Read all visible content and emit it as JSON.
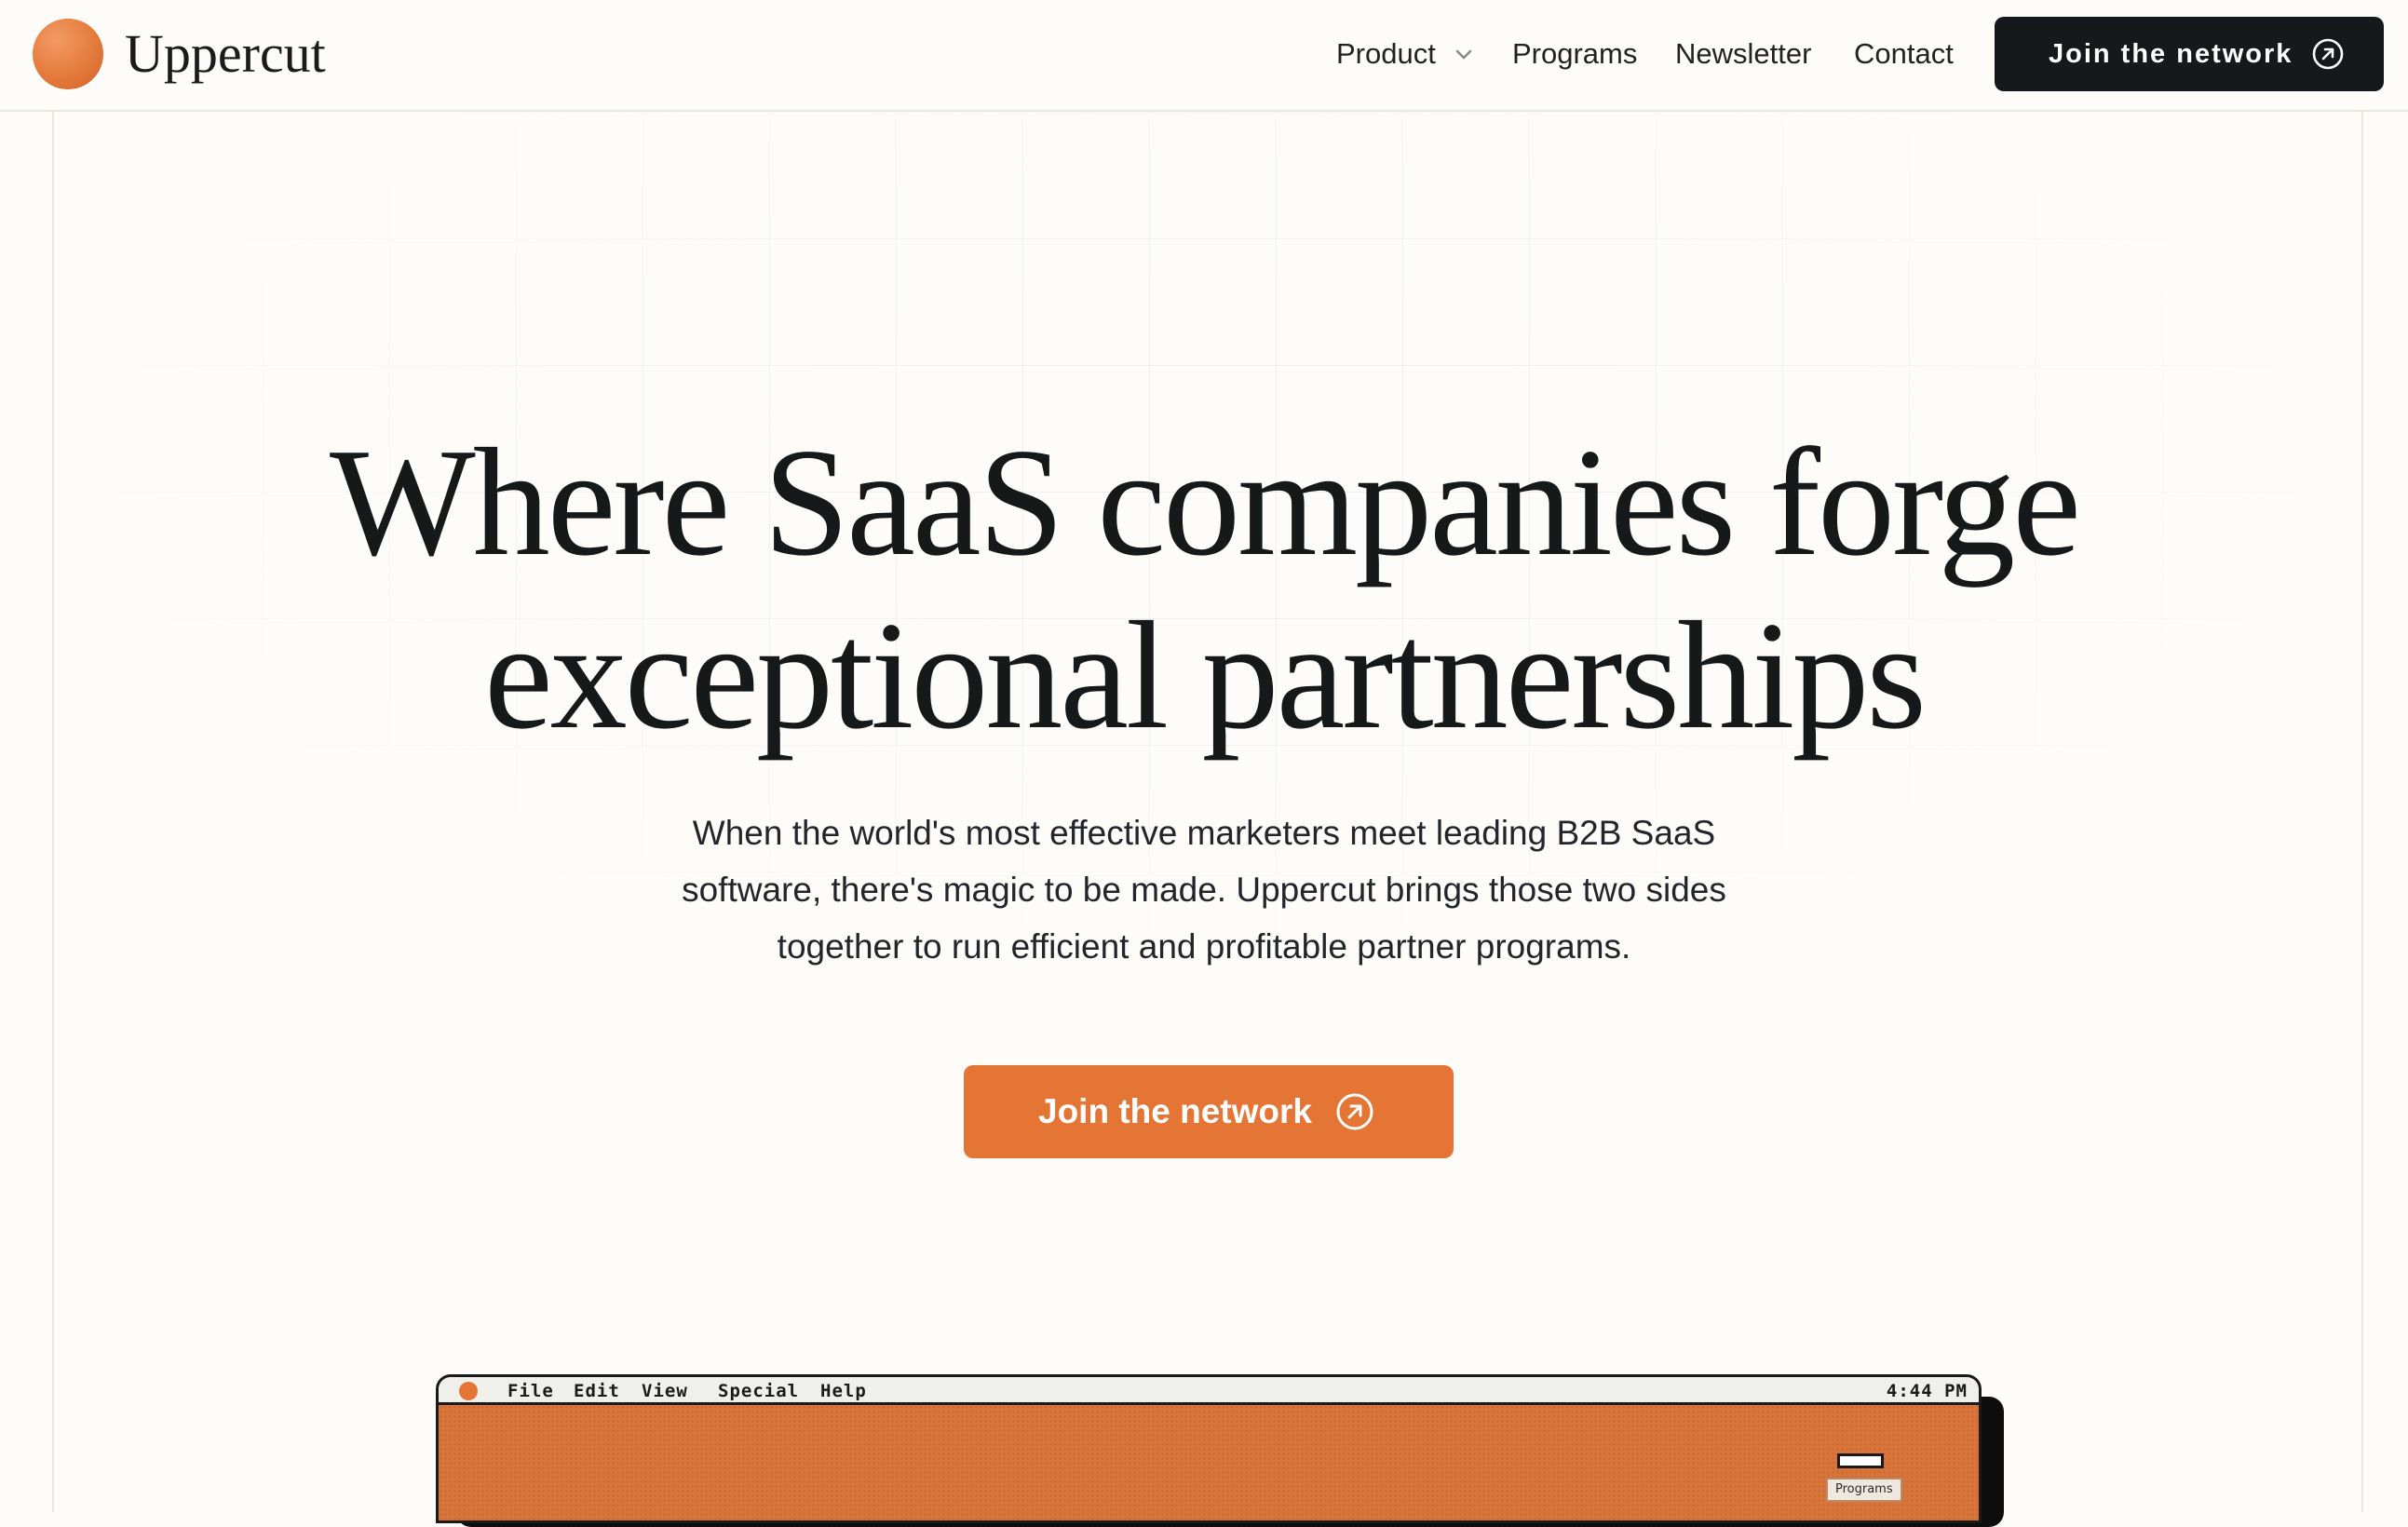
{
  "brand": {
    "name": "Uppercut",
    "accent": "#e57535",
    "dark": "#15191b"
  },
  "nav": {
    "items": [
      {
        "label": "Product",
        "has_dropdown": true
      },
      {
        "label": "Programs"
      },
      {
        "label": "Newsletter"
      },
      {
        "label": "Contact"
      }
    ],
    "cta_label": "Join the network",
    "cta_icon": "arrow-up-right-circle-icon"
  },
  "hero": {
    "headline_line1": "Where SaaS companies forge",
    "headline_line2": "exceptional partnerships",
    "subtext_line1": "When the world's most effective marketers meet leading B2B SaaS",
    "subtext_line2": "software, there's magic to be made. Uppercut brings those two sides",
    "subtext_line3": "together to run efficient and profitable partner programs.",
    "cta_label": "Join the network",
    "cta_icon": "arrow-up-right-circle-icon"
  },
  "desktop": {
    "menu": [
      "File",
      "Edit",
      "View",
      "Special",
      "Help"
    ],
    "clock": "4:44 PM",
    "folder_label": "Programs"
  }
}
